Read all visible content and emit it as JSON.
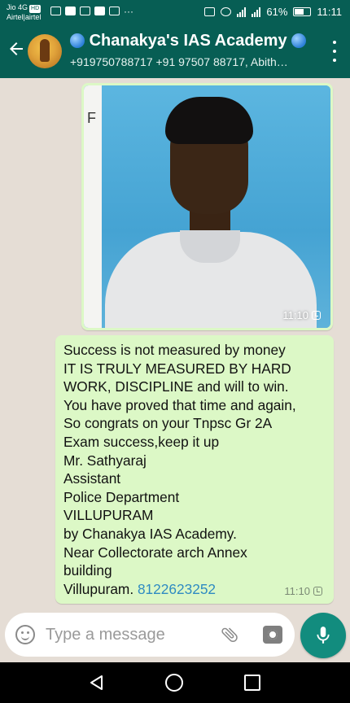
{
  "status_bar": {
    "carrier_top": "Jio 4G",
    "carrier_badge": "HD",
    "carrier_bottom": "Airtel|airtel",
    "overflow": "···",
    "battery_percent": "61%",
    "time": "11:11"
  },
  "header": {
    "title": "Chanakya's IAS Academy",
    "subtitle": "+919750788717 +91 97507 88717, Abith…"
  },
  "messages": {
    "image_message": {
      "time": "11:10",
      "photo_corner_letter": "F"
    },
    "text_message": {
      "lines": [
        "Success is not measured by money",
        "IT IS TRULY MEASURED BY HARD",
        "WORK, DISCIPLINE and will to win.",
        "You have proved that time and again,",
        "So congrats on your Tnpsc Gr 2A",
        "Exam success,keep it up",
        "Mr. Sathyaraj",
        "Assistant",
        "Police  Department",
        "VILLUPURAM",
        "by Chanakya IAS Academy.",
        "Near Collectorate arch Annex",
        "building"
      ],
      "last_line_text": "Villupuram. ",
      "phone_link": "8122623252",
      "time": "11:10"
    }
  },
  "composer": {
    "placeholder": "Type a message"
  },
  "colors": {
    "header": "#075e54",
    "bubble": "#dcf8c6",
    "chat_background": "#e5ddd5",
    "mic_button": "#128c7e",
    "link": "#2f8bc2"
  },
  "icons": {
    "back": "back-arrow-icon",
    "more": "more-vert-icon",
    "emoji": "emoji-icon",
    "attach": "paperclip-icon",
    "camera": "camera-icon",
    "mic": "mic-icon",
    "status": "clock-icon"
  }
}
